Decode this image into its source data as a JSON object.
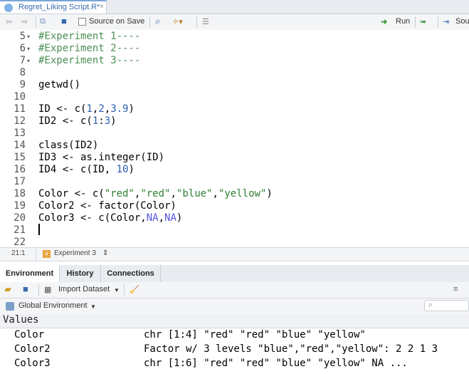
{
  "tab": {
    "file_name": "Regret_Liking Script.R*",
    "close": "×"
  },
  "toolbar": {
    "source_on_save": "Source on Save",
    "run": "Run",
    "source": "Sou"
  },
  "editor": {
    "lines": [
      {
        "n": "5",
        "fold": "▾",
        "text": "#Experiment 1----",
        "kind": "comment"
      },
      {
        "n": "6",
        "fold": "▾",
        "text": "#Experiment 2----",
        "kind": "comment"
      },
      {
        "n": "7",
        "fold": "▾",
        "text": "#Experiment 3----",
        "kind": "comment"
      },
      {
        "n": "8",
        "fold": "",
        "text": "",
        "kind": "code"
      },
      {
        "n": "9",
        "fold": "",
        "text": "getwd()",
        "kind": "code"
      },
      {
        "n": "10",
        "fold": "",
        "text": "",
        "kind": "code"
      },
      {
        "n": "11",
        "fold": "",
        "text": "ID <- c(1,2,3.9)",
        "kind": "code"
      },
      {
        "n": "12",
        "fold": "",
        "text": "ID2 <- c(1:3)",
        "kind": "code"
      },
      {
        "n": "13",
        "fold": "",
        "text": "",
        "kind": "code"
      },
      {
        "n": "14",
        "fold": "",
        "text": "class(ID2)",
        "kind": "code"
      },
      {
        "n": "15",
        "fold": "",
        "text": "ID3 <- as.integer(ID)",
        "kind": "code"
      },
      {
        "n": "16",
        "fold": "",
        "text": "ID4 <- c(ID, 10)",
        "kind": "code"
      },
      {
        "n": "17",
        "fold": "",
        "text": "",
        "kind": "code"
      },
      {
        "n": "18",
        "fold": "",
        "text": "Color <- c(\"red\",\"red\",\"blue\",\"yellow\")",
        "kind": "code"
      },
      {
        "n": "19",
        "fold": "",
        "text": "Color2 <- factor(Color)",
        "kind": "code"
      },
      {
        "n": "20",
        "fold": "",
        "text": "Color3 <- c(Color,NA,NA)",
        "kind": "code"
      },
      {
        "n": "21",
        "fold": "",
        "text": "",
        "kind": "code"
      },
      {
        "n": "22",
        "fold": "",
        "text": "",
        "kind": "code"
      }
    ]
  },
  "status": {
    "position": "21:1",
    "section": "Experiment 3",
    "section_arrow": "⇕"
  },
  "pane": {
    "tabs": [
      "Environment",
      "History",
      "Connections"
    ],
    "import_dataset": "Import Dataset",
    "global_env": "Global Environment",
    "values_header": "Values",
    "values": [
      {
        "name": "Color",
        "value": "chr [1:4] \"red\" \"red\" \"blue\" \"yellow\""
      },
      {
        "name": "Color2",
        "value": "Factor w/ 3 levels \"blue\",\"red\",\"yellow\": 2 2 1 3"
      },
      {
        "name": "Color3",
        "value": "chr [1:6] \"red\" \"red\" \"blue\" \"yellow\" NA ..."
      }
    ]
  }
}
